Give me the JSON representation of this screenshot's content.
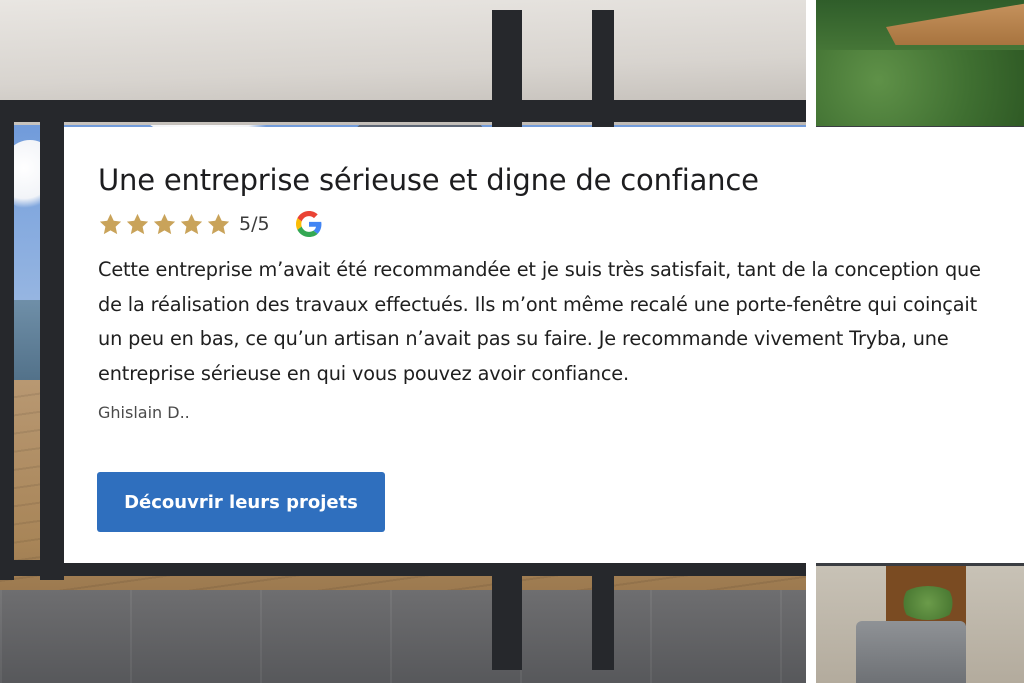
{
  "review": {
    "title": "Une entreprise sérieuse et digne de confiance",
    "rating": {
      "stars_filled": 5,
      "stars_total": 5,
      "score_text": "5/5",
      "star_color": "#c9a35a"
    },
    "source_icon": "google-logo-icon",
    "body_lines": [
      "Cette entreprise m’avait été recommandée et je suis très satisfait, tant de la conception que",
      "de la réalisation des travaux effectués. Ils m’ont même recalé une porte-fenêtre qui coinçait",
      "un peu en bas, ce qu’un artisan n’avait pas su faire. Je recommande vivement Tryba, une",
      "entreprise sérieuse en qui vous pouvez avoir confiance."
    ],
    "author": "Ghislain D..",
    "cta_label": "Découvrir leurs projets"
  },
  "colors": {
    "cta_background": "#2f6fbe",
    "card_background": "#ffffff",
    "text": "#1d1d1f"
  }
}
